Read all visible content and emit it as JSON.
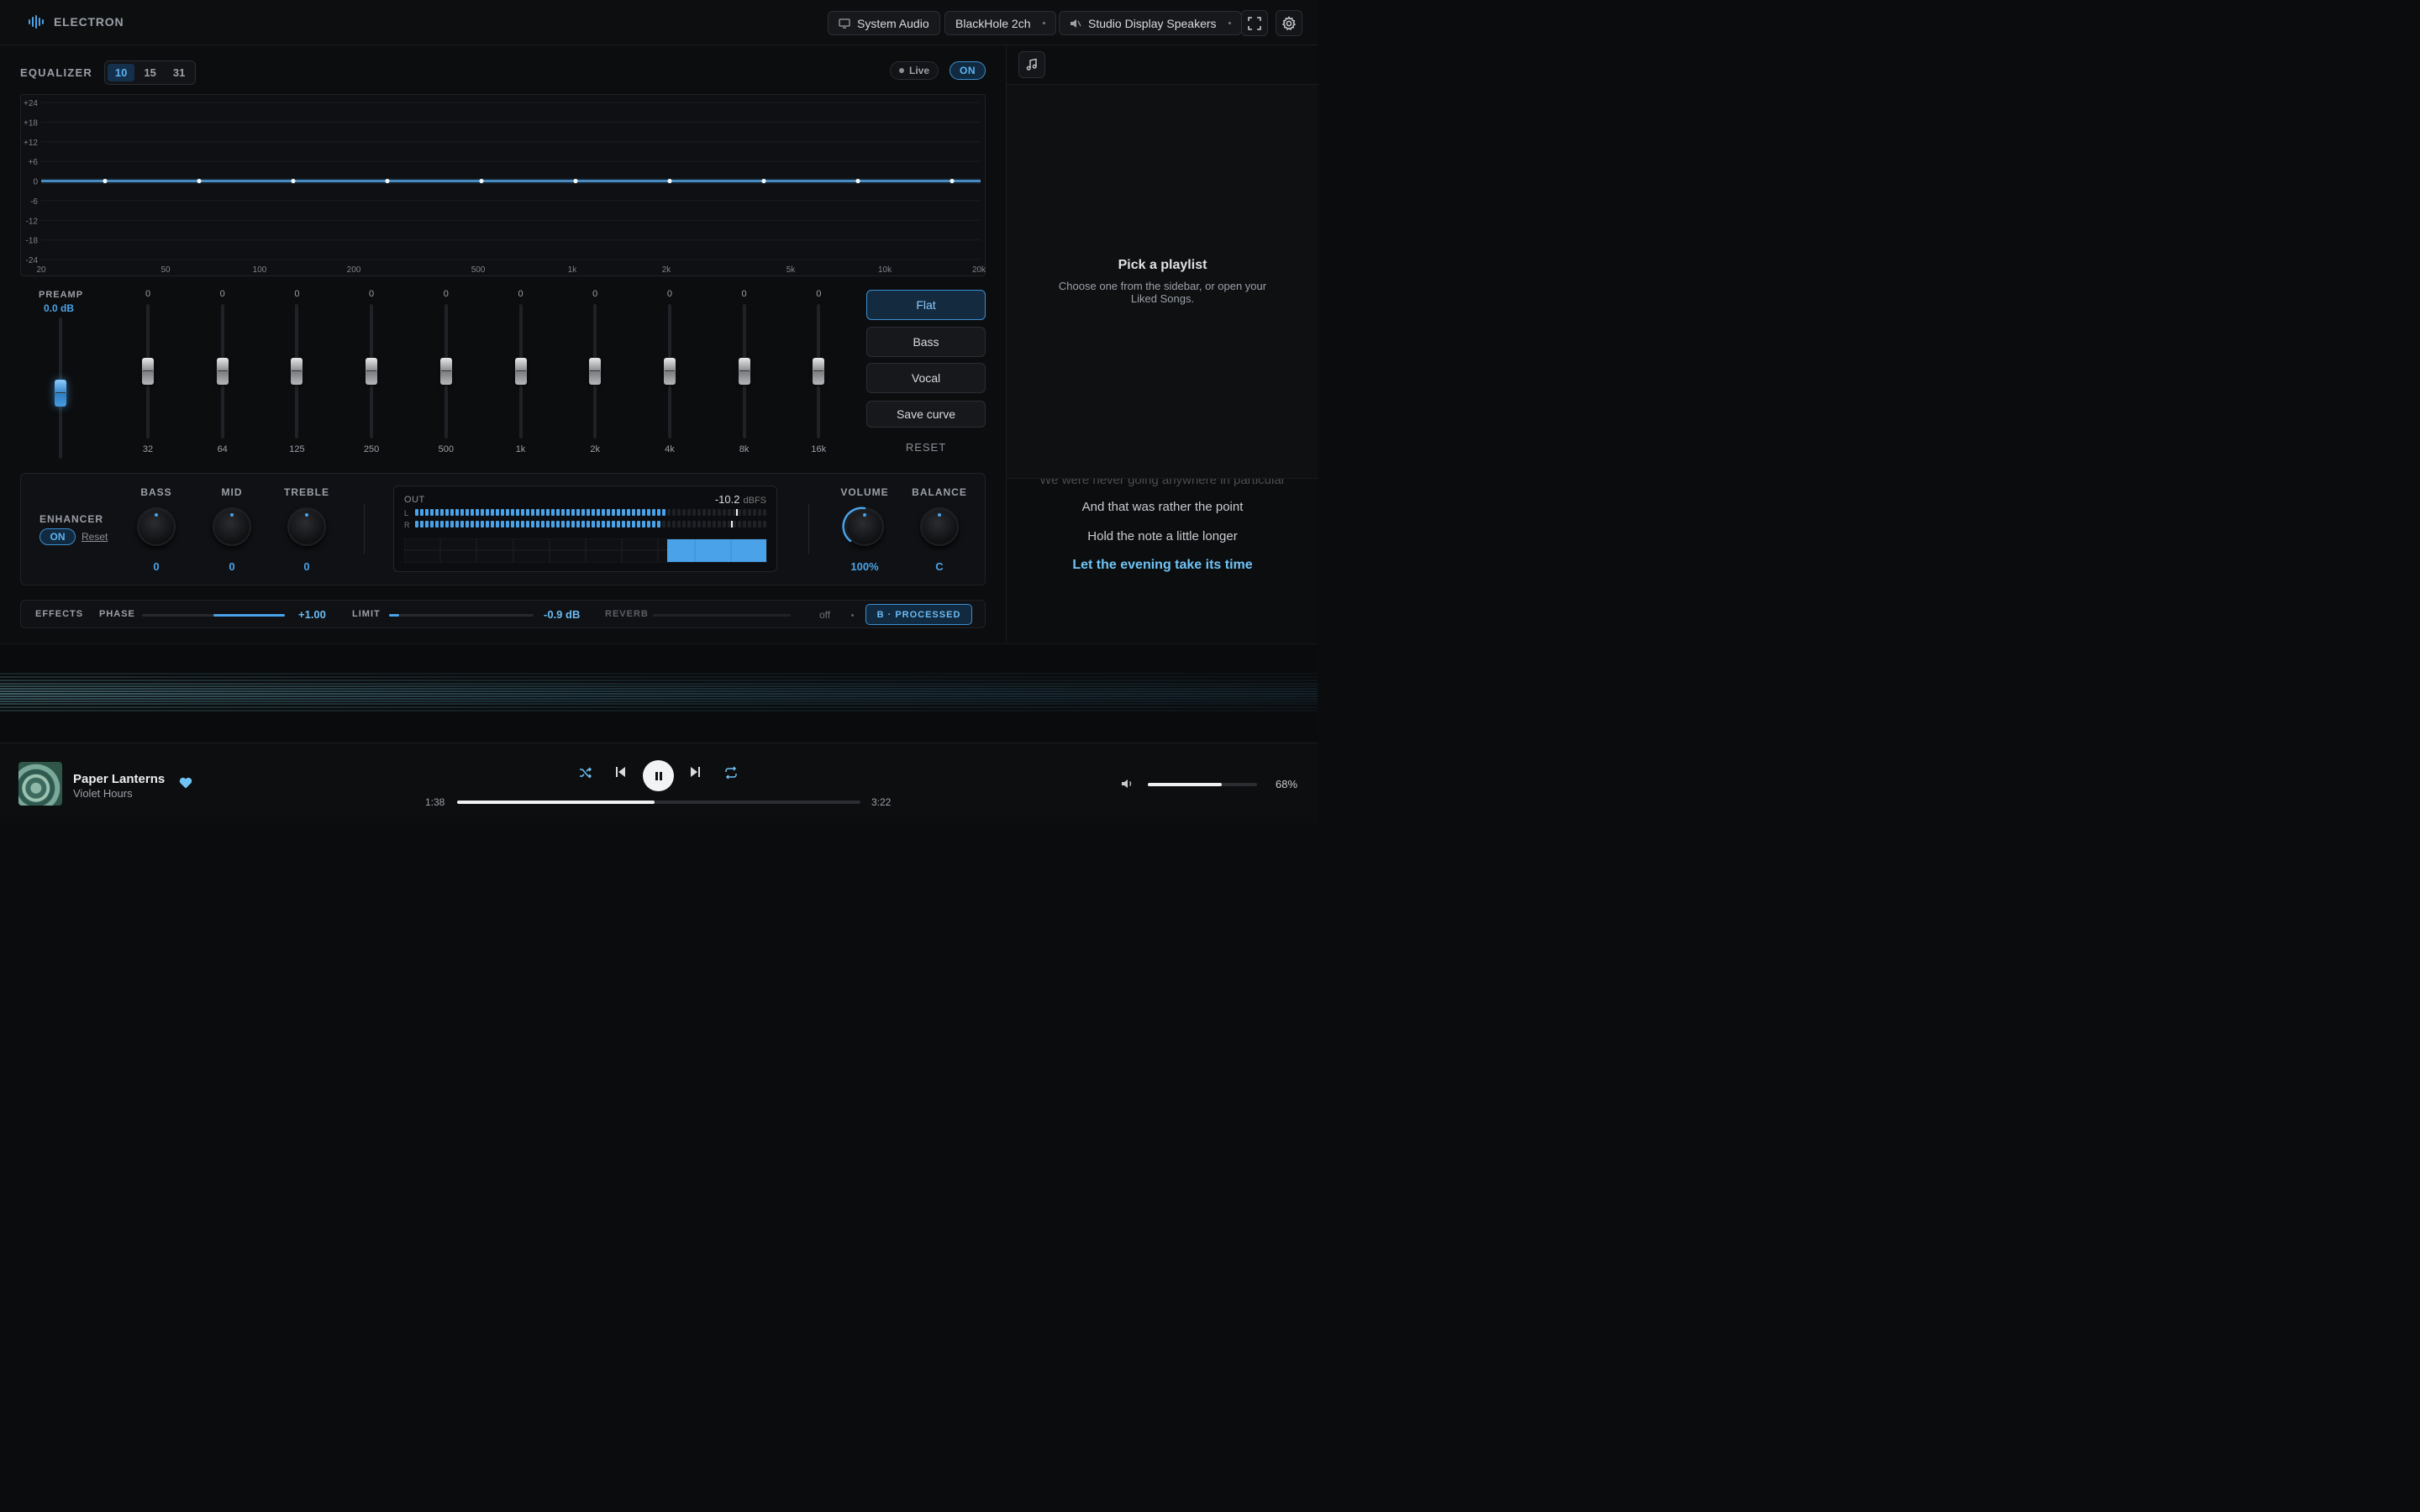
{
  "app": {
    "name": "ELECTRON"
  },
  "topbar": {
    "source": "System Audio",
    "device": "BlackHole 2ch",
    "output": "Studio Display Speakers"
  },
  "equalizer": {
    "title": "EQUALIZER",
    "band_modes": [
      "10",
      "15",
      "31"
    ],
    "active_mode": "10",
    "live_label": "Live",
    "on_label": "ON",
    "y_ticks": [
      "+24",
      "+18",
      "+12",
      "+6",
      "0",
      "-6",
      "-12",
      "-18",
      "-24"
    ],
    "x_ticks": [
      "20",
      "50",
      "100",
      "200",
      "500",
      "1k",
      "2k",
      "5k",
      "10k",
      "20k"
    ],
    "curve_gains_db": [
      0,
      0,
      0,
      0,
      0,
      0,
      0,
      0,
      0,
      0
    ],
    "preamp": {
      "label": "PREAMP",
      "value": "0.0 dB",
      "level": 0.5
    },
    "bands": [
      {
        "freq": "32",
        "gain": "0"
      },
      {
        "freq": "64",
        "gain": "0"
      },
      {
        "freq": "125",
        "gain": "0"
      },
      {
        "freq": "250",
        "gain": "0"
      },
      {
        "freq": "500",
        "gain": "0"
      },
      {
        "freq": "1k",
        "gain": "0"
      },
      {
        "freq": "2k",
        "gain": "0"
      },
      {
        "freq": "4k",
        "gain": "0"
      },
      {
        "freq": "8k",
        "gain": "0"
      },
      {
        "freq": "16k",
        "gain": "0"
      }
    ],
    "presets": [
      "Flat",
      "Bass",
      "Vocal"
    ],
    "active_preset": "Flat",
    "save_label": "Save curve",
    "reset_label": "RESET"
  },
  "enhancer": {
    "title": "ENHANCER",
    "on_label": "ON",
    "reset_label": "Reset",
    "knobs": [
      {
        "label": "BASS",
        "value": "0"
      },
      {
        "label": "MID",
        "value": "0"
      },
      {
        "label": "TREBLE",
        "value": "0"
      }
    ],
    "meter": {
      "out_label": "OUT",
      "db_value": "-10.2",
      "db_unit": "dBFS",
      "left_label": "L",
      "right_label": "R",
      "left_level": 0.72,
      "right_level": 0.7
    },
    "volume": {
      "label": "VOLUME",
      "value": "100%"
    },
    "balance": {
      "label": "BALANCE",
      "value": "C"
    }
  },
  "effects": {
    "title": "EFFECTS",
    "phase": {
      "label": "PHASE",
      "value": "+1.00",
      "fill": 0.5
    },
    "limit": {
      "label": "LIMIT",
      "value": "-0.9 dB",
      "fill": 0.07
    },
    "reverb": {
      "label": "REVERB",
      "value": "off"
    },
    "processed_label": "B · PROCESSED"
  },
  "right_panel": {
    "pick_title": "Pick a playlist",
    "pick_subtitle": "Choose one from the sidebar, or open your Liked Songs.",
    "lyrics": [
      "We were never going anywhere in particular",
      "And that was rather the point",
      "Hold the note a little longer",
      "Let the evening take its time"
    ]
  },
  "player": {
    "title": "Paper Lanterns",
    "artist": "Violet Hours",
    "elapsed": "1:38",
    "duration": "3:22",
    "progress": 0.49,
    "volume_pct": "68%",
    "volume": 0.68
  }
}
